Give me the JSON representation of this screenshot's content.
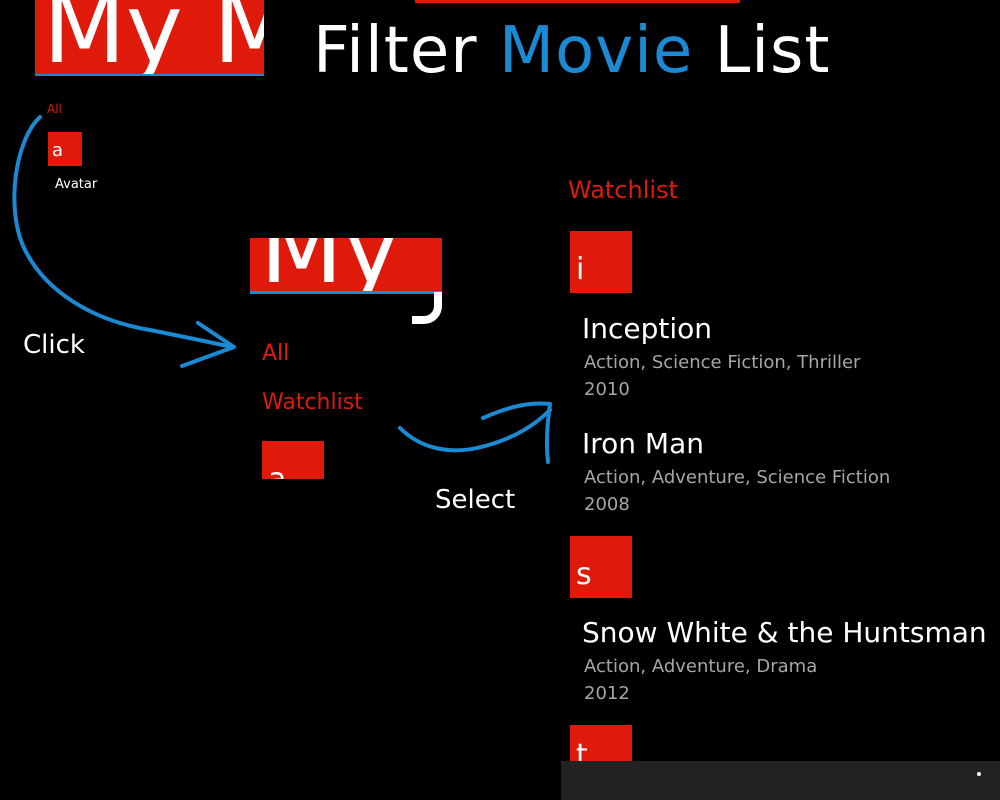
{
  "title": {
    "word1": "Filter",
    "word2": "Movie",
    "word3": "List"
  },
  "screen1": {
    "app_title": "My M",
    "filter_all": "All",
    "tile_letter": "a",
    "movie": "Avatar"
  },
  "screen2": {
    "app_title": "My",
    "filter_all": "All",
    "filter_watchlist": "Watchlist",
    "tile_letter": "a"
  },
  "annotations": {
    "click": "Click",
    "select": "Select"
  },
  "screen3": {
    "heading": "Watchlist",
    "groups": [
      {
        "letter": "i",
        "movies": [
          {
            "title": "Inception",
            "genres": "Action, Science Fiction, Thriller",
            "year": "2010"
          },
          {
            "title": "Iron Man",
            "genres": "Action, Adventure, Science Fiction",
            "year": "2008"
          }
        ]
      },
      {
        "letter": "s",
        "movies": [
          {
            "title": "Snow White & the Huntsman",
            "genres": "Action, Adventure, Drama",
            "year": "2012"
          }
        ]
      },
      {
        "letter": "t",
        "movies": []
      }
    ]
  },
  "colors": {
    "accent_red": "#e01a0b",
    "accent_blue": "#1a8ad4",
    "background": "#000000"
  }
}
